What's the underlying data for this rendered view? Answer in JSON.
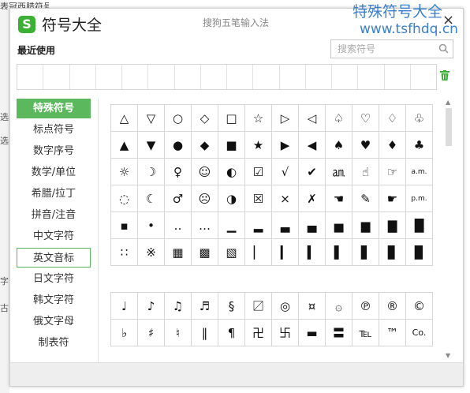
{
  "background": {
    "top_text": "表冠西腊符号",
    "fragments": [
      "选",
      "选",
      "字",
      "古"
    ]
  },
  "window": {
    "title": "符号大全",
    "ime_name": "搜狗五笔输入法",
    "logo_letter": "S",
    "close_glyph": "×"
  },
  "recent": {
    "label": "最近使用",
    "slots": 16
  },
  "search": {
    "placeholder": "搜索符号",
    "value": ""
  },
  "sidebar": {
    "items": [
      {
        "label": "特殊符号",
        "state": "selected"
      },
      {
        "label": "标点符号",
        "state": ""
      },
      {
        "label": "数字序号",
        "state": ""
      },
      {
        "label": "数学/单位",
        "state": ""
      },
      {
        "label": "希腊/拉丁",
        "state": ""
      },
      {
        "label": "拼音/注音",
        "state": ""
      },
      {
        "label": "中文字符",
        "state": ""
      },
      {
        "label": "英文音标",
        "state": "hover"
      },
      {
        "label": "日文字符",
        "state": ""
      },
      {
        "label": "韩文字符",
        "state": ""
      },
      {
        "label": "俄文字母",
        "state": ""
      },
      {
        "label": "制表符",
        "state": ""
      }
    ]
  },
  "grid1": {
    "rows": [
      [
        "△",
        "▽",
        "○",
        "◇",
        "□",
        "☆",
        "▷",
        "◁",
        "♤",
        "♡",
        "♢",
        "♧"
      ],
      [
        "▲",
        "▼",
        "●",
        "◆",
        "■",
        "★",
        "▶",
        "◀",
        "♠",
        "♥",
        "♦",
        "♣"
      ],
      [
        "☼",
        "☽",
        "♀",
        "☺",
        "◐",
        "☑",
        "√",
        "✔",
        "㏂",
        "☝",
        "☞",
        "a.m."
      ],
      [
        "◌",
        "☾",
        "♂",
        "☹",
        "◑",
        "☒",
        "×",
        "✗",
        "☚",
        "✎",
        "☛",
        "p.m."
      ],
      [
        "▪",
        "•",
        "‥",
        "…",
        "▁",
        "▂",
        "▃",
        "▄",
        "▅",
        "▆",
        "▇",
        "█"
      ],
      [
        "∷",
        "※",
        "▦",
        "▩",
        "▧",
        "▏",
        "▎",
        "▍",
        "▌",
        "▋",
        "▊",
        "▉"
      ]
    ]
  },
  "grid2": {
    "rows": [
      [
        "♩",
        "♪",
        "♫",
        "♬",
        "§",
        "〼",
        "◎",
        "¤",
        "۞",
        "℗",
        "®",
        "©"
      ],
      [
        "♭",
        "♯",
        "♮",
        "‖",
        "¶",
        "卍",
        "卐",
        "▬",
        "〓",
        "℡",
        "™",
        "Co."
      ]
    ]
  },
  "watermark": {
    "line1": "特殊符号大全",
    "line2": "www.tsfhdq.cn"
  },
  "colors": {
    "accent": "#5cb85c",
    "logo": "#3cb034",
    "watermark": "#3a7fcf"
  }
}
